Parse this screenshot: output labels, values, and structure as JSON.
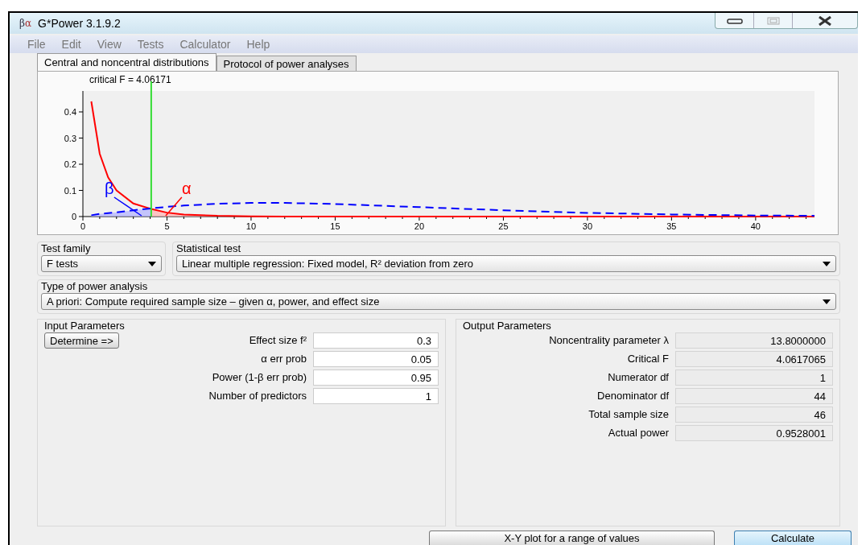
{
  "window": {
    "title": "G*Power 3.1.9.2",
    "logo": [
      "β",
      "α"
    ]
  },
  "menu": [
    "File",
    "Edit",
    "View",
    "Tests",
    "Calculator",
    "Help"
  ],
  "tabs": [
    {
      "label": "Central and noncentral distributions",
      "selected": true
    },
    {
      "label": "Protocol of power analyses",
      "selected": false
    }
  ],
  "distribution_plot": {
    "chart_data": {
      "type": "line",
      "title": "critical F = 4.06171",
      "x": [
        0.5,
        1,
        1.5,
        2,
        3,
        4,
        5,
        6,
        8,
        10,
        12,
        15,
        20,
        25,
        30,
        35,
        40,
        43.5
      ],
      "series": [
        {
          "color": "#ff0000",
          "line_style": "solid",
          "values": [
            0.44,
            0.24,
            0.15,
            0.1,
            0.05,
            0.03,
            0.015,
            0.008,
            0.003,
            0.001,
            0,
            0,
            0,
            0,
            0,
            0,
            0,
            0
          ]
        },
        {
          "color": "#0000ff",
          "line_style": "dashed",
          "values": [
            0.005,
            0.01,
            0.013,
            0.016,
            0.024,
            0.031,
            0.037,
            0.042,
            0.049,
            0.052,
            0.052,
            0.048,
            0.036,
            0.024,
            0.014,
            0.008,
            0.004,
            0.003
          ]
        }
      ],
      "xlim": [
        0,
        43.5
      ],
      "ylim": [
        0,
        0.48
      ],
      "xticks": [
        0,
        5,
        10,
        15,
        20,
        25,
        30,
        35,
        40
      ],
      "yticks": [
        0,
        0.1,
        0.2,
        0.3,
        0.4
      ],
      "ref_lines": [
        {
          "axis": "x",
          "value": 4.06171,
          "color": "#33dd33"
        }
      ],
      "annotations": [
        "β",
        "α"
      ]
    }
  },
  "test_family": {
    "label": "Test family",
    "value": "F tests"
  },
  "statistical_test": {
    "label": "Statistical test",
    "value": "Linear multiple regression: Fixed model, R² deviation from zero"
  },
  "power_analysis_type": {
    "label": "Type of power analysis",
    "value": "A priori: Compute required sample size – given α, power, and effect size"
  },
  "input_parameters": {
    "title": "Input Parameters",
    "determine_button": "Determine =>",
    "fields": [
      {
        "label": "Effect size f²",
        "value": "0.3"
      },
      {
        "label": "α err prob",
        "value": "0.05"
      },
      {
        "label": "Power (1-β err prob)",
        "value": "0.95"
      },
      {
        "label": "Number of predictors",
        "value": "1"
      }
    ]
  },
  "output_parameters": {
    "title": "Output Parameters",
    "fields": [
      {
        "label": "Noncentrality parameter λ",
        "value": "13.8000000"
      },
      {
        "label": "Critical F",
        "value": "4.0617065"
      },
      {
        "label": "Numerator df",
        "value": "1"
      },
      {
        "label": "Denominator df",
        "value": "44"
      },
      {
        "label": "Total sample size",
        "value": "46"
      },
      {
        "label": "Actual power",
        "value": "0.9528001"
      }
    ]
  },
  "buttons": [
    {
      "label": "X-Y plot for a range of values",
      "kind": "normal"
    },
    {
      "label": "Calculate",
      "kind": "default"
    }
  ]
}
